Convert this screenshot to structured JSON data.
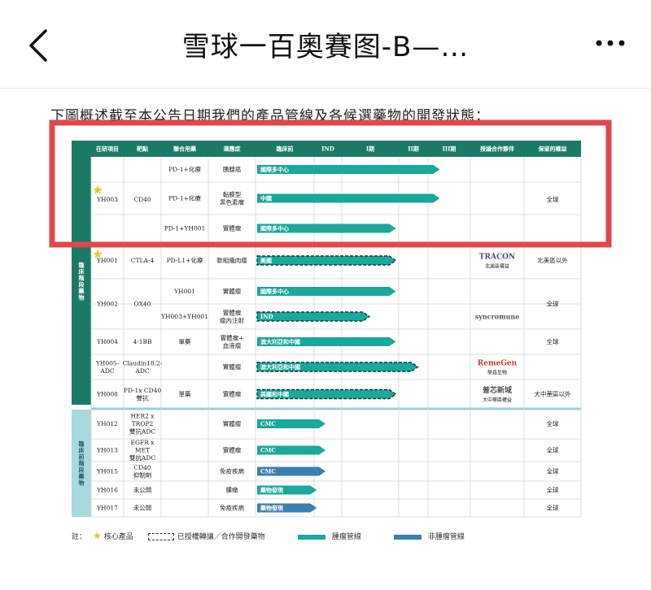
{
  "header": {
    "back_icon": "chevron-left-icon",
    "title": "雪球一百奧賽图-B—…",
    "more_icon": "more-dots-icon"
  },
  "caption": "下圖概述截至本公告日期我們的產品管線及各候選藥物的開發狀態：",
  "table": {
    "columns": [
      "在研項目",
      "靶點",
      "聯合用藥",
      "適應症",
      "臨床前",
      "IND",
      "I期",
      "II期",
      "III期",
      "授議合作夥伴",
      "保留的權益"
    ],
    "group_labels": [
      "臨床階段藥物",
      "臨床前階段藥物"
    ],
    "rows": [
      {
        "program": "YH003",
        "target": "CD40",
        "combo": "PD-1+化療",
        "indication": "胰腺癌",
        "bar": "國際多中心",
        "partner": "",
        "rights": "全球"
      },
      {
        "program": "",
        "target": "",
        "combo": "PD-1+化療",
        "indication": "黏膜型\n黑色素瘤",
        "bar": "中國",
        "partner": "",
        "rights": ""
      },
      {
        "program": "",
        "target": "",
        "combo": "PD-1+YH001",
        "indication": "實體瘤",
        "bar": "國際多中心",
        "partner": "",
        "rights": ""
      },
      {
        "program": "YH001",
        "target": "CTLA-4",
        "combo": "PD-L1+化療",
        "indication": "軟組織肉瘤",
        "bar": "美國",
        "partner": "TRACON",
        "partner_sub": "北美區權益",
        "rights": "北美區以外"
      },
      {
        "program": "YH002",
        "target": "OX40",
        "combo": "YH001",
        "indication": "實體瘤",
        "bar": "國際多中心",
        "partner": "",
        "rights": "全球"
      },
      {
        "program": "",
        "target": "",
        "combo": "YH003+YH001",
        "indication": "實體瘤\n瘤內注射",
        "bar": "IND",
        "partner": "syncromune",
        "rights": ""
      },
      {
        "program": "YH004",
        "target": "4-1BB",
        "combo": "單藥",
        "indication": "實體瘤+\n血液瘤",
        "bar": "澳大利亞和中國",
        "partner": "",
        "rights": "全球"
      },
      {
        "program": "YH005-\nADC",
        "target": "Claudin18.2-\nADC",
        "combo": "",
        "indication": "實體瘤",
        "bar": "澳大利亞和中國",
        "partner": "RemeGen",
        "partner_sub": "榮昌生物",
        "rights": ""
      },
      {
        "program": "YH008",
        "target": "PD-1x CD40\n雙抗",
        "combo": "單藥",
        "indication": "實體瘤",
        "bar": "美國和中國",
        "partner": "普芯新域",
        "partner_sub": "大中華區權益",
        "rights": "大中華區以外"
      },
      {
        "program": "YH012",
        "target": "HER2 x\nTROP2\n雙抗ADC",
        "combo": "",
        "indication": "實體瘤",
        "bar": "CMC",
        "partner": "",
        "rights": "全球"
      },
      {
        "program": "YH013",
        "target": "EGFR x\nMET\n雙抗ADC",
        "combo": "",
        "indication": "實體瘤",
        "bar": "CMC",
        "partner": "",
        "rights": "全球"
      },
      {
        "program": "YH015",
        "target": "CD40\n抑制劑",
        "combo": "",
        "indication": "免疫疾病",
        "bar": "CMC",
        "partner": "",
        "rights": "全球"
      },
      {
        "program": "YH016",
        "target": "未公開",
        "combo": "",
        "indication": "腫瘤",
        "bar": "藥物發現",
        "partner": "",
        "rights": "全球"
      },
      {
        "program": "YH017",
        "target": "未公開",
        "combo": "",
        "indication": "免疫疾病",
        "bar": "藥物發現",
        "partner": "",
        "rights": "全球"
      }
    ],
    "progress_fraction": [
      0.72,
      0.72,
      0.52,
      0.52,
      0.52,
      0.4,
      0.52,
      0.62,
      0.52,
      0.2,
      0.2,
      0.2,
      0.16,
      0.16
    ],
    "dashed_rows": [
      3,
      5,
      7,
      8
    ],
    "oncology_color": "#1aa89a",
    "non_oncology_color": "#3b7fb0"
  },
  "legend": {
    "note": "註：",
    "core": "核心產品",
    "licensed": "已授權轉讓／合作開發藥物",
    "onco": "腫瘤管線",
    "non_onco": "非腫瘤管線"
  },
  "highlight_color": "#e0474c"
}
